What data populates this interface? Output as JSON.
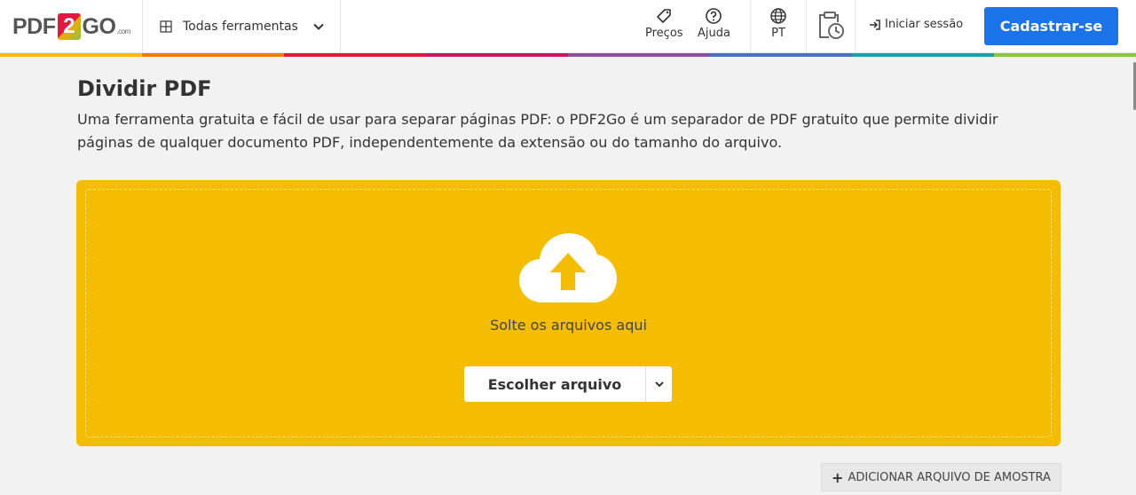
{
  "header": {
    "logo": {
      "pre": "PDF",
      "two": "2",
      "post": "GO",
      "com": ".com"
    },
    "all_tools_label": "Todas ferramentas",
    "pricing_label": "Preços",
    "help_label": "Ajuda",
    "language_label": "PT",
    "login_label": "Iniciar sessão",
    "signup_label": "Cadastrar-se"
  },
  "page": {
    "title": "Dividir PDF",
    "description": "Uma ferramenta gratuita e fácil de usar para separar páginas PDF: o PDF2Go é um separador de PDF gratuito que permite dividir páginas de qualquer documento PDF, independentemente da extensão ou do tamanho do arquivo."
  },
  "upload": {
    "drop_text": "Solte os arquivos aqui",
    "choose_label": "Escolher arquivo",
    "sample_label": "ADICIONAR ARQUIVO DE AMOSTRA"
  },
  "colors": {
    "accent": "#1a73e8",
    "dropzone": "#f5bd00",
    "rainbow": [
      "#f5bd00",
      "#ee7d00",
      "#e5173f",
      "#c8175f",
      "#8e4fa0",
      "#4d6fc1",
      "#1aa0a8",
      "#17a672"
    ]
  },
  "icons": [
    "grid-icon",
    "chevron-down-icon",
    "tag-icon",
    "help-icon",
    "globe-icon",
    "clipboard-clock-icon",
    "login-icon",
    "cloud-upload-icon",
    "plus-icon"
  ]
}
